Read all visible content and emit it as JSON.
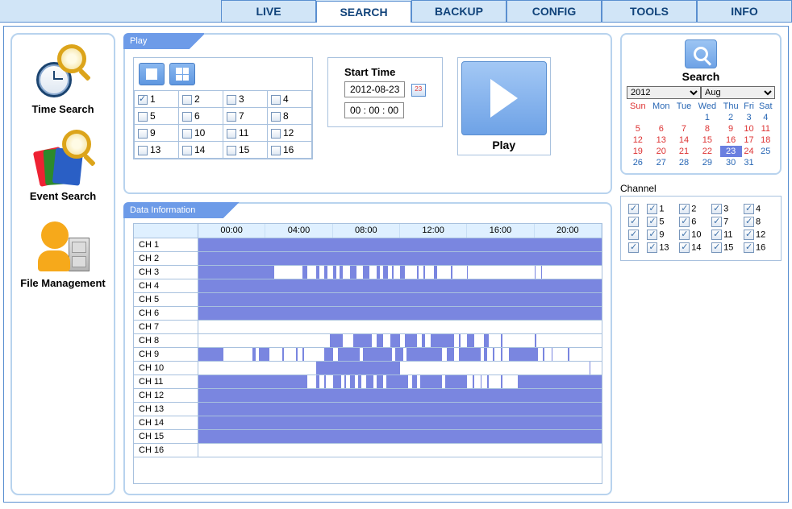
{
  "tabs": [
    "LIVE",
    "SEARCH",
    "BACKUP",
    "CONFIG",
    "TOOLS",
    "INFO"
  ],
  "active_tab": "SEARCH",
  "sidebar": [
    {
      "label": "Time Search"
    },
    {
      "label": "Event Search"
    },
    {
      "label": "File Management"
    }
  ],
  "play_panel": {
    "title": "Play",
    "cameras": [
      1,
      2,
      3,
      4,
      5,
      6,
      7,
      8,
      9,
      10,
      11,
      12,
      13,
      14,
      15,
      16
    ],
    "checked": [
      1
    ],
    "start_time_label": "Start Time",
    "date": "2012-08-23",
    "time": "00 : 00 : 00",
    "play_label": "Play"
  },
  "data_panel": {
    "title": "Data Information",
    "hours": [
      "00:00",
      "04:00",
      "08:00",
      "12:00",
      "16:00",
      "20:00"
    ],
    "channels": [
      "CH 1",
      "CH 2",
      "CH 3",
      "CH 4",
      "CH 5",
      "CH 6",
      "CH 7",
      "CH 8",
      "CH 9",
      "CH 10",
      "CH 11",
      "CH 12",
      "CH 13",
      "CH 14",
      "CH 15",
      "CH 16"
    ]
  },
  "chart_data": {
    "type": "timeline",
    "x_range_hours": [
      0,
      24
    ],
    "segments": {
      "CH 1": [
        [
          0,
          24
        ]
      ],
      "CH 2": [
        [
          0,
          24
        ]
      ],
      "CH 3": [
        [
          0,
          4.5
        ],
        [
          6.2,
          6.5
        ],
        [
          7.0,
          7.2
        ],
        [
          7.5,
          7.7
        ],
        [
          8.0,
          8.2
        ],
        [
          8.4,
          8.6
        ],
        [
          9.0,
          9.4
        ],
        [
          9.8,
          10.2
        ],
        [
          10.6,
          10.8
        ],
        [
          11.0,
          11.3
        ],
        [
          11.5,
          11.6
        ],
        [
          12.0,
          12.3
        ],
        [
          13.0,
          13.1
        ],
        [
          13.4,
          13.5
        ],
        [
          14.0,
          14.2
        ],
        [
          15.0,
          15.1
        ],
        [
          16.0,
          16.05
        ],
        [
          20.0,
          20.05
        ],
        [
          20.4,
          20.45
        ]
      ],
      "CH 4": [
        [
          0,
          24
        ]
      ],
      "CH 5": [
        [
          0,
          24
        ]
      ],
      "CH 6": [
        [
          0,
          24
        ]
      ],
      "CH 7": [],
      "CH 8": [
        [
          7.8,
          8.6
        ],
        [
          9.2,
          10.3
        ],
        [
          10.6,
          11.0
        ],
        [
          11.4,
          12.0
        ],
        [
          12.3,
          13.0
        ],
        [
          13.3,
          13.5
        ],
        [
          13.8,
          15.2
        ],
        [
          15.5,
          15.6
        ],
        [
          16.0,
          16.4
        ],
        [
          17.0,
          17.3
        ],
        [
          18.0,
          18.1
        ],
        [
          20.0,
          20.1
        ]
      ],
      "CH 9": [
        [
          0,
          1.5
        ],
        [
          3.2,
          3.4
        ],
        [
          3.6,
          4.2
        ],
        [
          5.0,
          5.1
        ],
        [
          5.8,
          5.9
        ],
        [
          6.2,
          6.3
        ],
        [
          7.5,
          8.0
        ],
        [
          8.3,
          9.6
        ],
        [
          9.8,
          11.5
        ],
        [
          11.7,
          12.2
        ],
        [
          12.4,
          14.5
        ],
        [
          14.8,
          15.2
        ],
        [
          15.5,
          16.8
        ],
        [
          17.0,
          17.2
        ],
        [
          17.5,
          17.6
        ],
        [
          18.0,
          18.1
        ],
        [
          18.5,
          20.2
        ],
        [
          20.5,
          20.6
        ],
        [
          21.0,
          21.05
        ],
        [
          22.0,
          22.1
        ]
      ],
      "CH 10": [
        [
          7.0,
          12.0
        ],
        [
          23.3,
          23.35
        ]
      ],
      "CH 11": [
        [
          0,
          6.5
        ],
        [
          7.0,
          7.2
        ],
        [
          7.5,
          7.6
        ],
        [
          8.0,
          8.5
        ],
        [
          8.7,
          8.8
        ],
        [
          9.0,
          9.3
        ],
        [
          9.5,
          9.7
        ],
        [
          10.0,
          10.4
        ],
        [
          10.6,
          11.0
        ],
        [
          11.2,
          12.5
        ],
        [
          12.7,
          13.0
        ],
        [
          13.2,
          14.5
        ],
        [
          14.7,
          16.0
        ],
        [
          16.3,
          16.4
        ],
        [
          16.8,
          16.85
        ],
        [
          17.2,
          17.3
        ],
        [
          18.0,
          18.1
        ],
        [
          19.0,
          24
        ]
      ],
      "CH 12": [
        [
          0,
          24
        ]
      ],
      "CH 13": [
        [
          0,
          24
        ]
      ],
      "CH 14": [
        [
          0,
          24
        ]
      ],
      "CH 15": [
        [
          0,
          24
        ]
      ],
      "CH 16": []
    }
  },
  "search": {
    "label": "Search",
    "year": "2012",
    "month": "Aug",
    "dow": [
      "Sun",
      "Mon",
      "Tue",
      "Wed",
      "Thu",
      "Fri",
      "Sat"
    ],
    "weeks": [
      [
        "",
        "",
        "",
        "1",
        "2",
        "3",
        "4"
      ],
      [
        "5",
        "6",
        "7",
        "8",
        "9",
        "10",
        "11"
      ],
      [
        "12",
        "13",
        "14",
        "15",
        "16",
        "17",
        "18"
      ],
      [
        "19",
        "20",
        "21",
        "22",
        "23",
        "24",
        "25"
      ],
      [
        "26",
        "27",
        "28",
        "29",
        "30",
        "31",
        ""
      ]
    ],
    "selected_day": "23",
    "red_days": [
      "5",
      "6",
      "7",
      "8",
      "9",
      "10",
      "11",
      "12",
      "13",
      "14",
      "15",
      "16",
      "17",
      "18",
      "19",
      "20",
      "21",
      "22",
      "24"
    ],
    "blue_days": [
      "1",
      "2",
      "3",
      "4",
      "25",
      "26",
      "27",
      "28",
      "29",
      "30",
      "31"
    ]
  },
  "channel": {
    "label": "Channel",
    "all_checked": true,
    "items": [
      1,
      2,
      3,
      4,
      5,
      6,
      7,
      8,
      9,
      10,
      11,
      12,
      13,
      14,
      15,
      16
    ]
  }
}
